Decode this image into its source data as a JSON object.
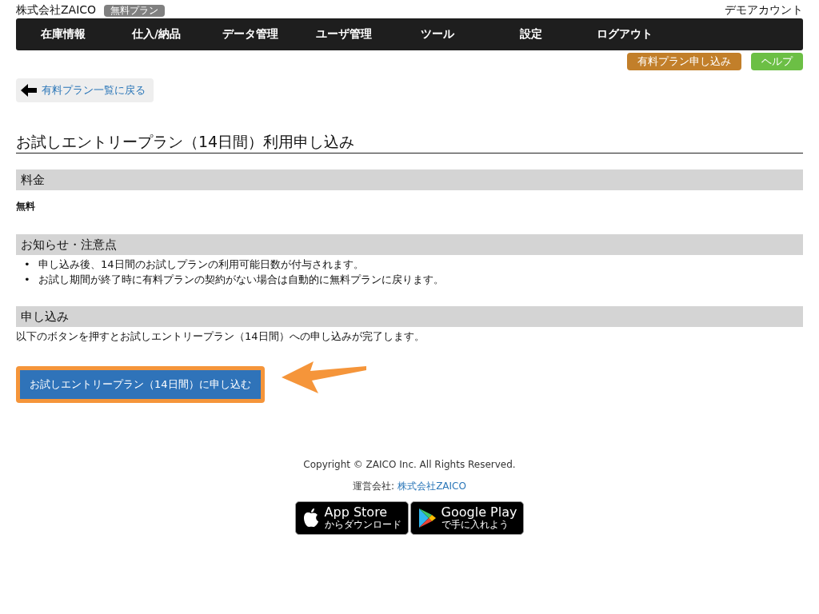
{
  "header": {
    "company": "株式会社ZAICO",
    "plan_badge": "無料プラン",
    "account": "デモアカウント"
  },
  "nav": [
    "在庫情報",
    "仕入/納品",
    "データ管理",
    "ユーザ管理",
    "ツール",
    "設定",
    "ログアウト"
  ],
  "sub_buttons": [
    {
      "label": "有料プラン申し込み",
      "color": "#c27f2a"
    },
    {
      "label": "ヘルプ",
      "color": "#6cbf45"
    }
  ],
  "back_link": "有料プラン一覧に戻る",
  "title": "お試しエントリープラン（14日間）利用申し込み",
  "sections": [
    {
      "heading": "料金",
      "kind": "value",
      "text": "無料"
    },
    {
      "heading": "お知らせ・注意点",
      "kind": "list",
      "items": [
        {
          "marker": "•",
          "text": "申し込み後、14日間のお試しプランの利用可能日数が付与されます。"
        },
        {
          "marker": "•",
          "text": "お試し期間が終了時に有料プランの契約がない場合は自動的に無料プランに戻ります。"
        }
      ]
    },
    {
      "heading": "申し込み",
      "kind": "text",
      "text": "以下のボタンを押すとお試しエントリープラン（14日間）への申し込みが完了します。"
    }
  ],
  "submit_button": "お試しエントリープラン（14日間）に申し込む",
  "footer": {
    "copyright": "Copyright © ZAICO Inc. All Rights Reserved.",
    "operator_label": "運営会社:",
    "operator_link": "株式会社ZAICO",
    "badges": [
      {
        "kind": "apple",
        "title": "App Store",
        "subtitle": "からダウンロード"
      },
      {
        "kind": "google",
        "title": "Google Play",
        "subtitle": "で手に入れよう"
      }
    ]
  }
}
